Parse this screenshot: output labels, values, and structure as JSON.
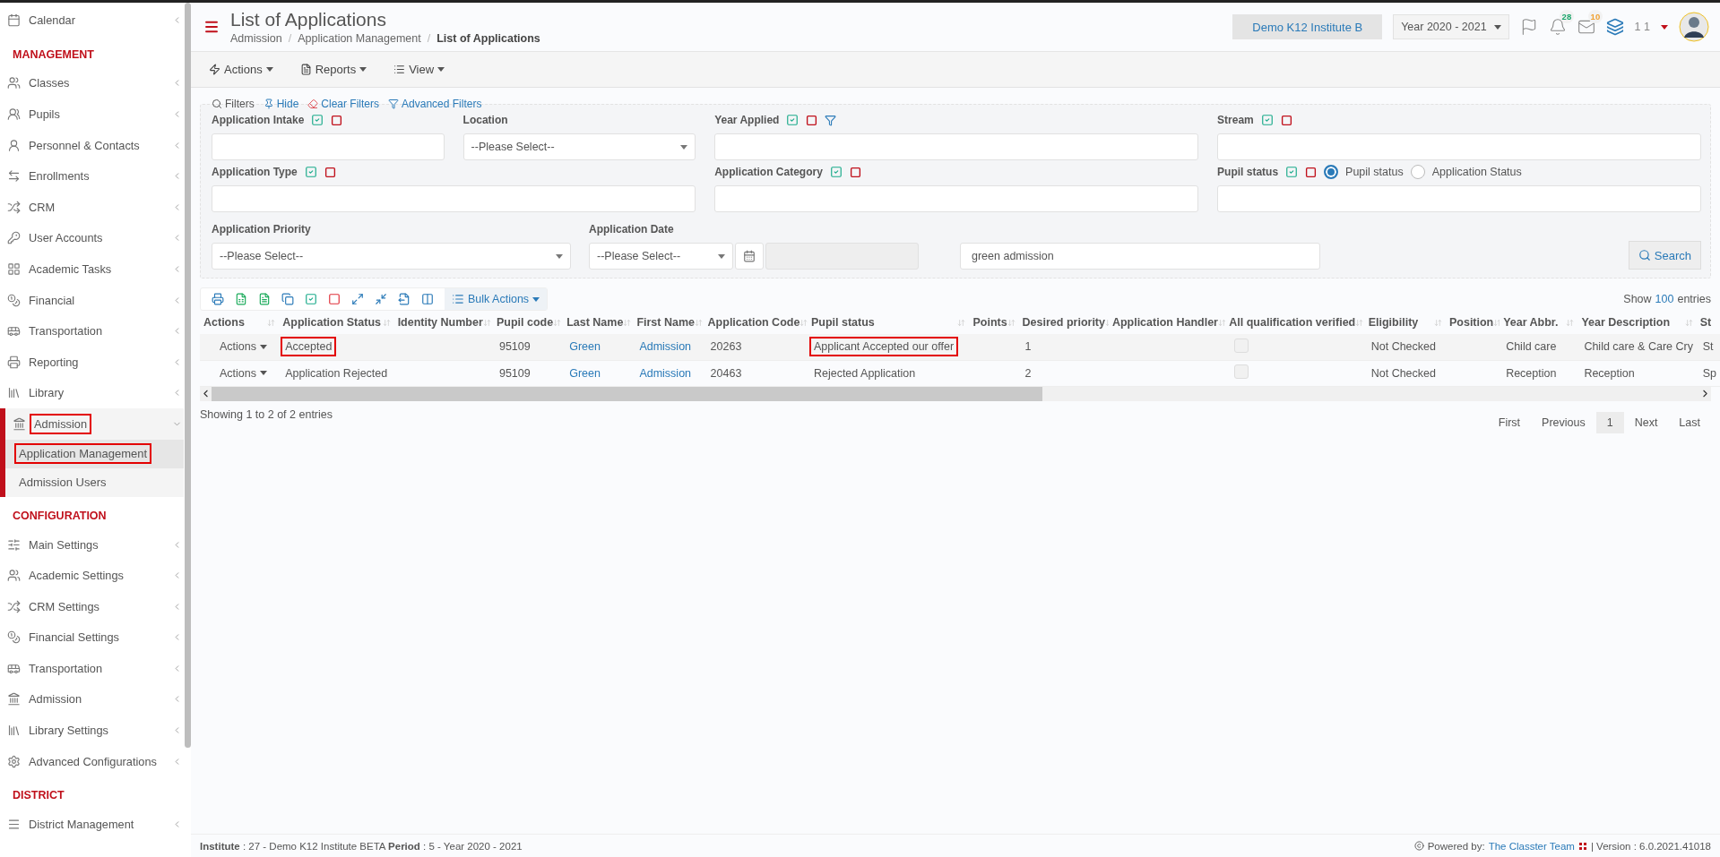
{
  "sidebar": {
    "items": [
      {
        "label": "Calendar",
        "expanded": false,
        "selected": false,
        "marked": false
      }
    ],
    "sections": [
      {
        "title": "MANAGEMENT",
        "items": [
          {
            "label": "Classes",
            "expanded": false,
            "selected": false,
            "marked": false
          },
          {
            "label": "Pupils",
            "expanded": false,
            "selected": false,
            "marked": false
          },
          {
            "label": "Personnel & Contacts",
            "expanded": false,
            "selected": false,
            "marked": false
          },
          {
            "label": "Enrollments",
            "expanded": false,
            "selected": false,
            "marked": false
          },
          {
            "label": "CRM",
            "expanded": false,
            "selected": false,
            "marked": false
          },
          {
            "label": "User Accounts",
            "expanded": false,
            "selected": false,
            "marked": false
          },
          {
            "label": "Academic Tasks",
            "expanded": false,
            "selected": false,
            "marked": false
          },
          {
            "label": "Financial",
            "expanded": false,
            "selected": false,
            "marked": false
          },
          {
            "label": "Transportation",
            "expanded": false,
            "selected": false,
            "marked": false
          },
          {
            "label": "Reporting",
            "expanded": false,
            "selected": false,
            "marked": false
          },
          {
            "label": "Library",
            "expanded": false,
            "selected": false,
            "marked": false
          },
          {
            "label": "Admission",
            "expanded": true,
            "selected": false,
            "marked": true,
            "children": [
              {
                "label": "Application Management",
                "selected": true,
                "marked": true
              },
              {
                "label": "Admission Users",
                "selected": false,
                "marked": false
              }
            ]
          }
        ]
      },
      {
        "title": "CONFIGURATION",
        "items": [
          {
            "label": "Main Settings",
            "expanded": false,
            "selected": false,
            "marked": false
          },
          {
            "label": "Academic Settings",
            "expanded": false,
            "selected": false,
            "marked": false
          },
          {
            "label": "CRM Settings",
            "expanded": false,
            "selected": false,
            "marked": false
          },
          {
            "label": "Financial Settings",
            "expanded": false,
            "selected": false,
            "marked": false
          },
          {
            "label": "Transportation",
            "expanded": false,
            "selected": false,
            "marked": false
          },
          {
            "label": "Admission",
            "expanded": false,
            "selected": false,
            "marked": false
          },
          {
            "label": "Library Settings",
            "expanded": false,
            "selected": false,
            "marked": false
          },
          {
            "label": "Advanced Configurations",
            "expanded": false,
            "selected": false,
            "marked": false
          }
        ]
      },
      {
        "title": "DISTRICT",
        "items": [
          {
            "label": "District Management",
            "expanded": false,
            "selected": false,
            "marked": false
          }
        ]
      }
    ]
  },
  "header": {
    "title": "List of Applications",
    "separators": [
      "/",
      "/"
    ],
    "breadcrumbs": [
      {
        "label": "Admission",
        "current": false
      },
      {
        "label": "Application Management",
        "current": false
      },
      {
        "label": "List of Applications",
        "current": true
      }
    ],
    "institute": "Demo K12 Institute B",
    "year": "Year 2020 - 2021",
    "notifications": "28",
    "messages": "10",
    "user": "1 1"
  },
  "toolbar": [
    "Actions",
    "Reports",
    "View"
  ],
  "filters": {
    "links": [
      "Filters",
      "Hide",
      "Clear Filters",
      "Advanced Filters"
    ],
    "fields": [
      {
        "label": "Application Intake",
        "kind": "text",
        "toggles": true,
        "funnel": false
      },
      {
        "label": "Location",
        "kind": "select",
        "placeholder": "--Please Select--",
        "toggles": false,
        "funnel": false
      },
      {
        "label": "Year Applied",
        "kind": "text",
        "toggles": true,
        "funnel": true
      },
      {
        "label": "Stream",
        "kind": "text",
        "toggles": true,
        "funnel": false
      },
      {
        "label": "Application Type",
        "kind": "text",
        "toggles": true,
        "funnel": false
      },
      {
        "label": "Application Category",
        "kind": "text",
        "toggles": true,
        "funnel": false
      },
      {
        "label": "Pupil status",
        "kind": "text",
        "toggles": true,
        "funnel": false,
        "options": [
          {
            "label": "Pupil status",
            "selected": true
          },
          {
            "label": "Application Status",
            "selected": false
          }
        ]
      }
    ],
    "priority": {
      "label": "Application Priority",
      "placeholder": "--Please Select--"
    },
    "date": {
      "label": "Application Date",
      "placeholder": "--Please Select--"
    },
    "keyword": {
      "value": "green admission"
    },
    "search_button": "Search"
  },
  "table": {
    "bulk_actions": "Bulk Actions",
    "show": "Show",
    "page_size": "100",
    "entries": "entries",
    "columns": [
      "Actions",
      "Application Status",
      "Identity Number",
      "Pupil code",
      "Last Name",
      "First Name",
      "Application Code",
      "Pupil status",
      "Points",
      "Desired priority",
      "Application Handler",
      "All qualification verified",
      "Eligibility",
      "Position",
      "Year Abbr.",
      "Year Description",
      "St"
    ],
    "rows": [
      {
        "actions": "Actions",
        "application_status": "Accepted",
        "application_status_marked": true,
        "pupil_code": "95109",
        "last_name": "Green",
        "first_name": "Admission",
        "application_code": "20263",
        "pupil_status": "Applicant Accepted our offer",
        "pupil_status_marked": true,
        "desired_priority": "1",
        "all_qualification_verified": false,
        "eligibility": "Not Checked",
        "year_abbr": "Child care",
        "year_description": "Child care & Care Cry",
        "column_17": "St"
      },
      {
        "actions": "Actions",
        "application_status": "Application Rejected",
        "application_status_marked": false,
        "pupil_code": "95109",
        "last_name": "Green",
        "first_name": "Admission",
        "application_code": "20463",
        "pupil_status": "Rejected Application",
        "pupil_status_marked": false,
        "desired_priority": "2",
        "all_qualification_verified": false,
        "eligibility": "Not Checked",
        "year_abbr": "Reception",
        "year_description": "Reception",
        "column_17": "Sp"
      }
    ],
    "info": "Showing 1 to 2 of 2 entries",
    "pages": [
      {
        "label": "First",
        "selected": false
      },
      {
        "label": "Previous",
        "selected": false
      },
      {
        "label": "1",
        "selected": true
      },
      {
        "label": "Next",
        "selected": false
      },
      {
        "label": "Last",
        "selected": false
      }
    ]
  },
  "footer": {
    "info": "**Institute** : 27 - Demo K12 Institute BETA **Period** : 5 - Year 2020 - 2021",
    "powered": "Powered by:",
    "team": "The Classter Team",
    "version": "| Version : 6.0.2021.41018"
  }
}
